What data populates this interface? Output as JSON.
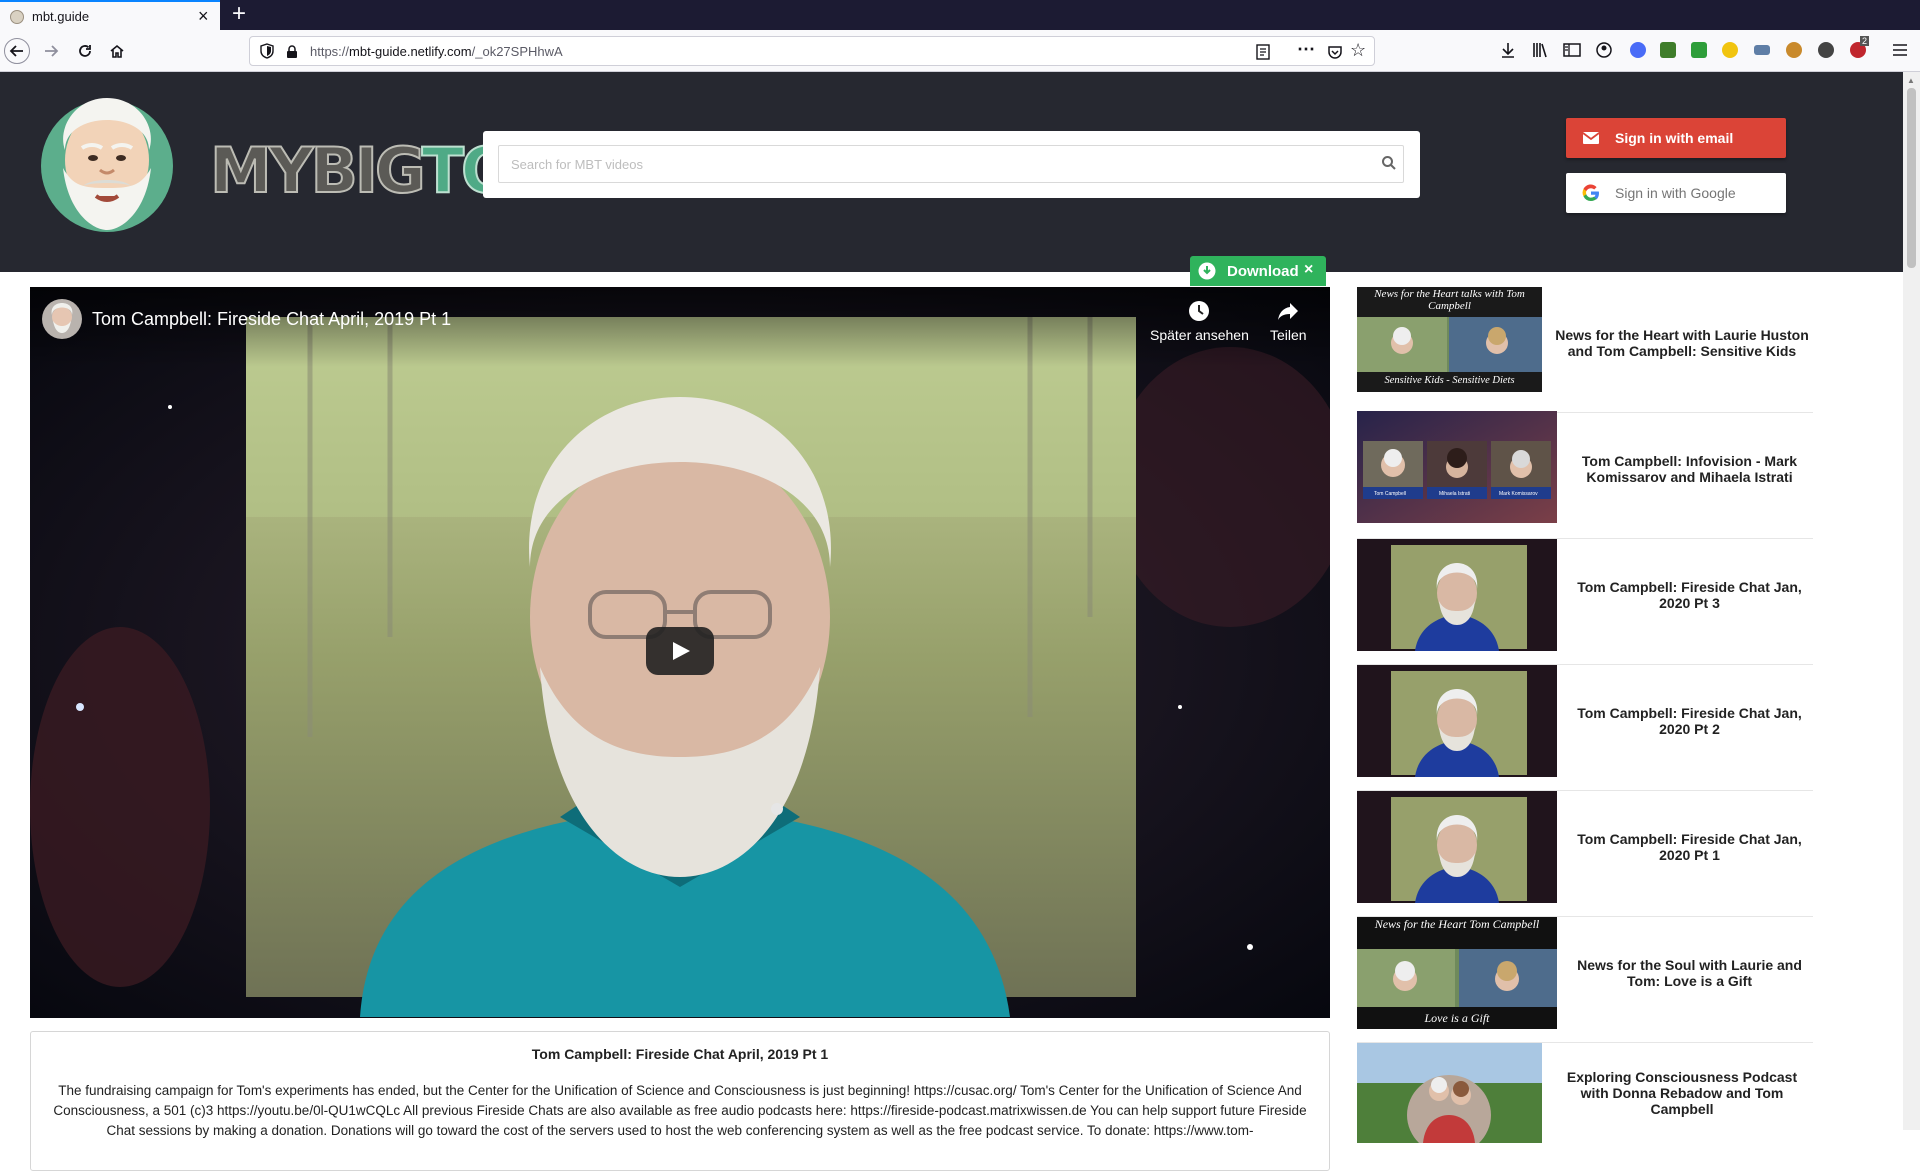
{
  "browser": {
    "tab_title": "mbt.guide",
    "tab_close": "×",
    "new_tab": "+",
    "url_prefix": "https://",
    "url_host": "mbt-guide.netlify.com",
    "url_path": "/_ok27SPHhwA",
    "icons": [
      "back-icon",
      "forward-icon",
      "reload-icon",
      "home-icon",
      "shield-icon",
      "lock-icon",
      "reader-view-icon",
      "more-icon",
      "pocket-icon",
      "bookmark-star-icon",
      "download-arrow-icon",
      "library-icon",
      "sidebar-icon",
      "account-icon",
      "extension-icons",
      "menu-icon"
    ],
    "ext_badge": "2"
  },
  "header": {
    "logo_my_big": "MYBIG",
    "logo_toe": "TOE",
    "search_placeholder": "Search for MBT videos",
    "email_button": "Sign in with email",
    "google_button": "Sign in with Google",
    "colors": {
      "header_bg": "#262830",
      "email_red": "#db4437",
      "download_green": "#2fb35c"
    }
  },
  "download": {
    "label": "Download",
    "close": "×"
  },
  "video": {
    "title": "Tom Campbell: Fireside Chat April, 2019 Pt 1",
    "watch_later": "Später ansehen",
    "share": "Teilen"
  },
  "description": {
    "title": "Tom Campbell: Fireside Chat April, 2019 Pt 1",
    "body": "The fundraising campaign for Tom's experiments has ended, but the Center for the Unification of Science and Consciousness is just beginning! https://cusac.org/ Tom's Center for the Unification of Science And Consciousness, a 501 (c)3 https://youtu.be/0l-QU1wCQLc All previous Fireside Chats are also available as free audio podcasts here: https://fireside-podcast.matrixwissen.de You can help support future Fireside Chat sessions by making a donation. Donations will go toward the cost of the servers used to host the web conferencing system as well as the free podcast service. To donate: https://www.tom-"
  },
  "sidebar": {
    "items": [
      {
        "title": "News for the Heart with Laurie Huston and Tom Campbell: Sensitive Kids",
        "thumb_top": "News for the Heart talks with Tom Campbell",
        "thumb_bottom": "Sensitive Kids - Sensitive Diets"
      },
      {
        "title": "Tom Campbell: Infovision - Mark Komissarov and Mihaela Istrati",
        "thumb_labels": [
          "Tom Campbell",
          "Mihaela Istrati",
          "Mark Komissarov"
        ]
      },
      {
        "title": "Tom Campbell: Fireside Chat Jan, 2020 Pt 3"
      },
      {
        "title": "Tom Campbell: Fireside Chat Jan, 2020 Pt 2"
      },
      {
        "title": "Tom Campbell: Fireside Chat Jan, 2020 Pt 1"
      },
      {
        "title": "News for the Soul with Laurie and Tom: Love is a Gift",
        "thumb_top": "News for the Heart Tom Campbell",
        "thumb_bottom": "Love is a Gift"
      },
      {
        "title": "Exploring Consciousness Podcast with Donna Rebadow and Tom Campbell"
      }
    ]
  }
}
